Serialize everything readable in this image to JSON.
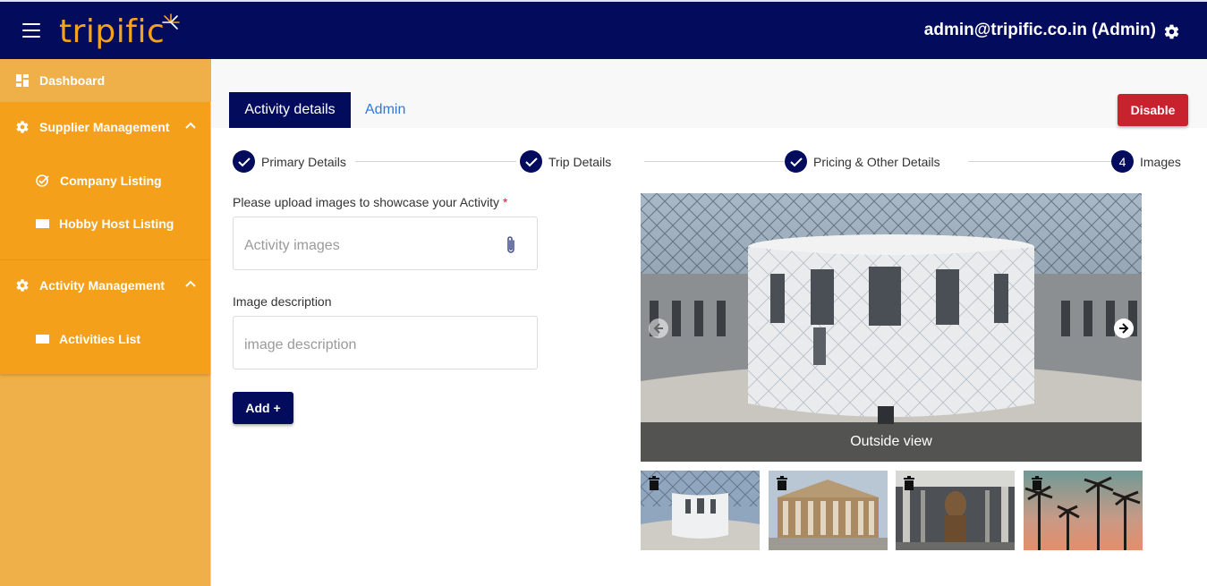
{
  "header": {
    "logo_text": "tripific",
    "user": "admin@tripific.co.in (Admin)",
    "brand_color": "#020b5c",
    "accent_color": "#f5a01a"
  },
  "sidebar": {
    "dashboard": "Dashboard",
    "groups": [
      {
        "label": "Supplier Management",
        "items": [
          "Company Listing",
          "Hobby Host Listing"
        ]
      },
      {
        "label": "Activity Management",
        "items": [
          "Activities List"
        ]
      }
    ]
  },
  "tabs": {
    "active": "Activity details",
    "other": "Admin"
  },
  "actions": {
    "disable": "Disable",
    "add": "Add +"
  },
  "stepper": {
    "steps": [
      {
        "label": "Primary Details",
        "status": "done"
      },
      {
        "label": "Trip Details",
        "status": "done"
      },
      {
        "label": "Pricing & Other Details",
        "status": "done"
      },
      {
        "label": "Images",
        "number": "4",
        "status": "current"
      }
    ]
  },
  "form": {
    "upload_label": "Please upload images to showcase your Activity",
    "required_mark": "*",
    "upload_placeholder": "Activity images",
    "description_label": "Image description",
    "description_placeholder": "image description"
  },
  "carousel": {
    "caption": "Outside view"
  }
}
